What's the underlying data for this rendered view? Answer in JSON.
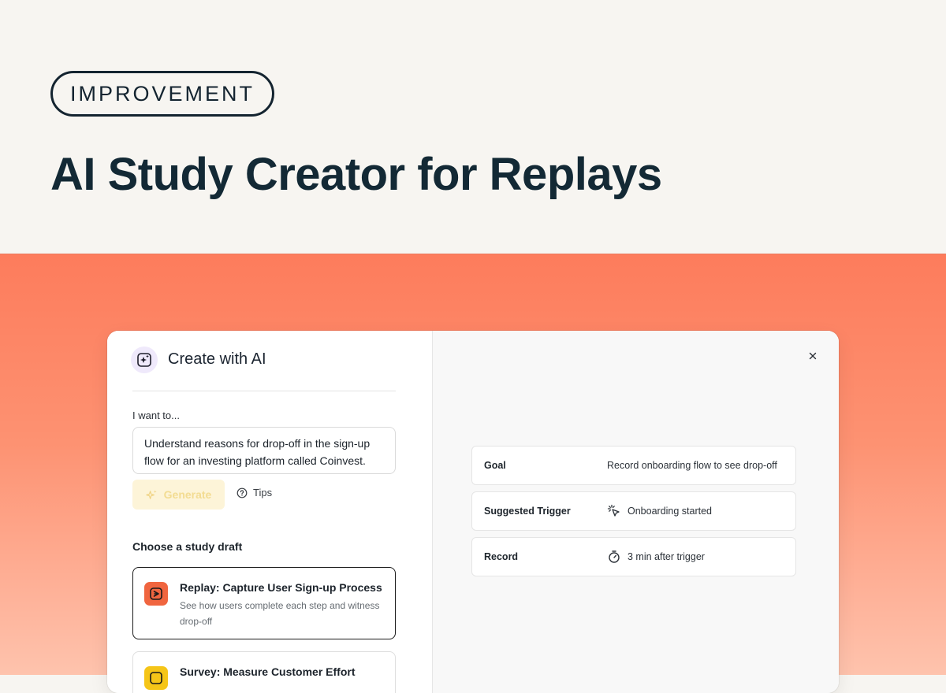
{
  "hero": {
    "badge": "IMPROVEMENT",
    "headline": "AI Study Creator for Replays"
  },
  "modal": {
    "title": "Create with AI",
    "want_label": "I want to...",
    "prompt_value": "Understand reasons for drop-off in the sign-up flow for an investing platform called Coinvest.",
    "generate_label": "Generate",
    "tips_label": "Tips",
    "choose_label": "Choose a study draft",
    "drafts": [
      {
        "title": "Replay: Capture User Sign-up Process",
        "description": "See how users complete each step and witness drop-off",
        "icon": "replay-icon",
        "color": "#f0653f"
      },
      {
        "title": "Survey: Measure Customer Effort",
        "icon": "survey-icon",
        "color": "#f5c518"
      }
    ],
    "details": [
      {
        "key": "Goal",
        "value": "Record onboarding flow to see drop-off"
      },
      {
        "key": "Suggested Trigger",
        "value": "Onboarding started",
        "icon": "cursor-click-icon"
      },
      {
        "key": "Record",
        "value": "3 min after trigger",
        "icon": "stopwatch-icon"
      }
    ]
  },
  "colors": {
    "headline": "#132935",
    "stage_top": "#fd7c5c",
    "stage_bottom": "#fec3ad",
    "generate_bg": "#fdf4d8",
    "ai_icon_bg": "#efe9fb"
  }
}
